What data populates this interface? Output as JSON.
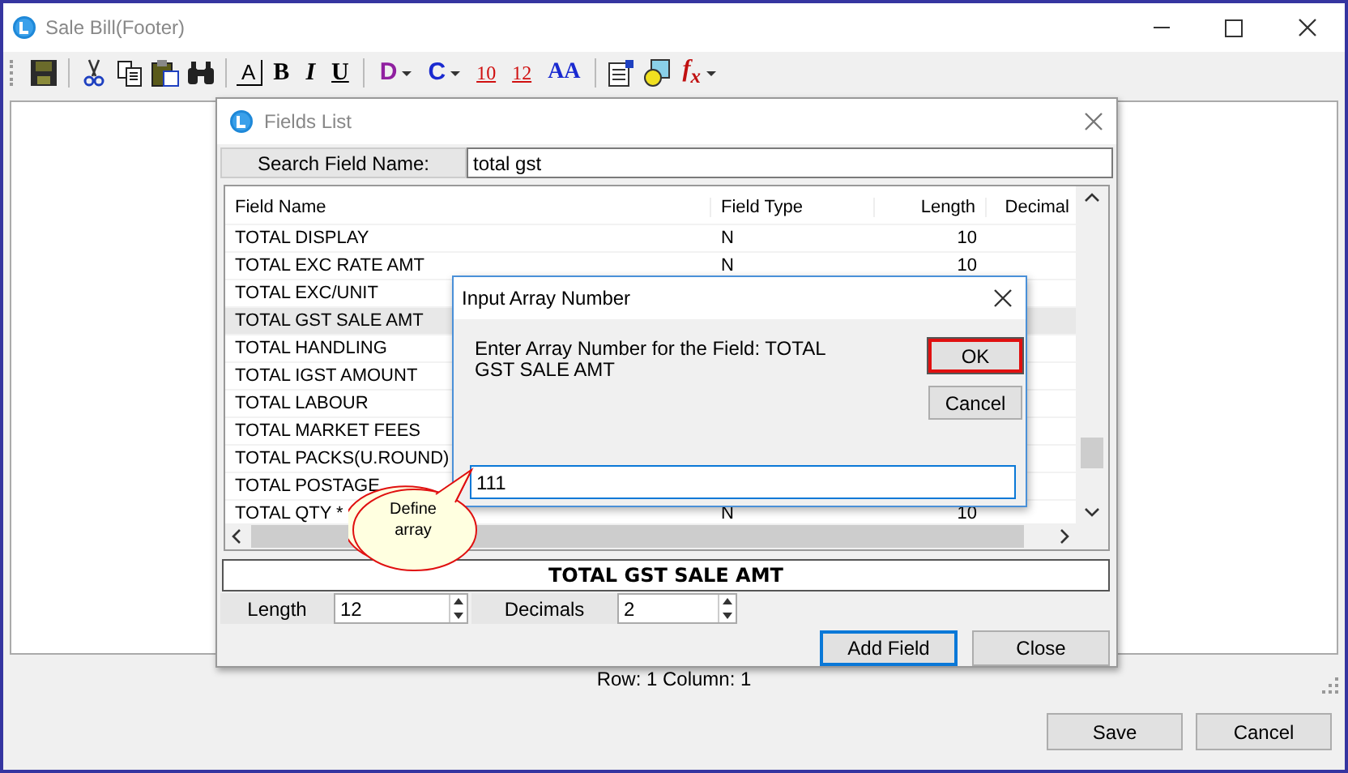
{
  "window": {
    "title": "Sale Bill(Footer)"
  },
  "toolbar": [
    {
      "kind": "save"
    },
    {
      "kind": "sep"
    },
    {
      "kind": "cut"
    },
    {
      "kind": "copy"
    },
    {
      "kind": "paste"
    },
    {
      "kind": "find"
    },
    {
      "kind": "sep"
    },
    {
      "kind": "boxed",
      "text": "A"
    },
    {
      "kind": "bold",
      "text": "B"
    },
    {
      "kind": "italic",
      "text": "I"
    },
    {
      "kind": "underline",
      "text": "U"
    },
    {
      "kind": "sep"
    },
    {
      "kind": "dmenu",
      "text": "D"
    },
    {
      "kind": "cmenu",
      "text": "C"
    },
    {
      "kind": "num",
      "text": "10"
    },
    {
      "kind": "num",
      "text": "12"
    },
    {
      "kind": "fonts",
      "text": "AA"
    },
    {
      "kind": "sep"
    },
    {
      "kind": "props"
    },
    {
      "kind": "shapes"
    },
    {
      "kind": "fxmenu",
      "text": "f$_{x}$"
    }
  ],
  "status": "Row: 1  Column: 1",
  "buttons": [
    {
      "label": "Save"
    },
    {
      "label": "Cancel"
    }
  ],
  "fields_list": {
    "title": "Fields List",
    "search": {
      "label": "Search Field Name:",
      "value": "total gst"
    },
    "columns": [
      "Field Name",
      "Field Type",
      "Length",
      "Decimal"
    ],
    "rows": [
      {
        "field_name": "TOTAL DISPLAY",
        "field_type": "N",
        "length": "10",
        "selected": false
      },
      {
        "field_name": "TOTAL EXC RATE AMT",
        "field_type": "N",
        "length": "10",
        "selected": false
      },
      {
        "field_name": "TOTAL EXC/UNIT",
        "selected": false
      },
      {
        "field_name": "TOTAL GST SALE AMT",
        "selected": true
      },
      {
        "field_name": "TOTAL HANDLING",
        "selected": false
      },
      {
        "field_name": "TOTAL IGST AMOUNT",
        "selected": false
      },
      {
        "field_name": "TOTAL LABOUR",
        "selected": false
      },
      {
        "field_name": "TOTAL MARKET FEES",
        "selected": false
      },
      {
        "field_name": "TOTAL PACKS(U.ROUND)",
        "selected": false
      },
      {
        "field_name": "TOTAL POSTAGE",
        "selected": false
      },
      {
        "field_name": "TOTAL QTY *",
        "field_type": "N",
        "length": "10",
        "selected": false
      }
    ],
    "selected_name": "TOTAL GST SALE AMT",
    "length": {
      "label": "Length",
      "value": "12"
    },
    "decimals": {
      "label": "Decimals",
      "value": "2"
    },
    "buttons": [
      {
        "label": "Add Field",
        "default": true
      },
      {
        "label": "Close",
        "default": false
      }
    ]
  },
  "array_dialog": {
    "title": "Input Array Number",
    "message": "Enter Array Number for the Field: TOTAL GST SALE AMT",
    "value": "111",
    "buttons": [
      {
        "label": "OK",
        "highlighted": true
      },
      {
        "label": "Cancel",
        "highlighted": false
      }
    ]
  },
  "callout": {
    "text": "Define array"
  }
}
